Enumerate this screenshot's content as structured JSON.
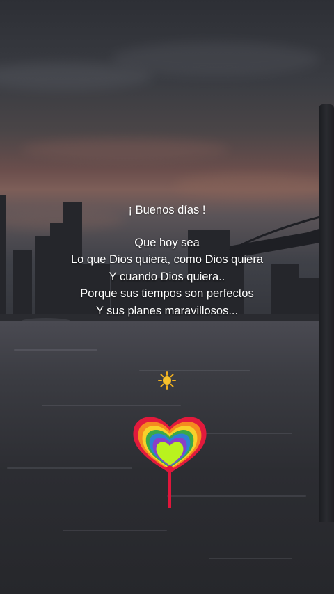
{
  "message": {
    "greeting": "¡  Buenos días  !",
    "lines": [
      "Que hoy sea",
      "Lo que Dios quiera, como Dios quiera",
      "Y cuando Dios quiera..",
      "Porque sus tiempos son perfectos",
      "Y sus planes maravillosos..."
    ]
  },
  "stickers": {
    "sun": "sun-icon",
    "heart": "rainbow-heart-lollipop-icon"
  },
  "colors": {
    "text": "#ffffff",
    "sky_glow": "#7d5e58",
    "water": "#2c2d32"
  }
}
